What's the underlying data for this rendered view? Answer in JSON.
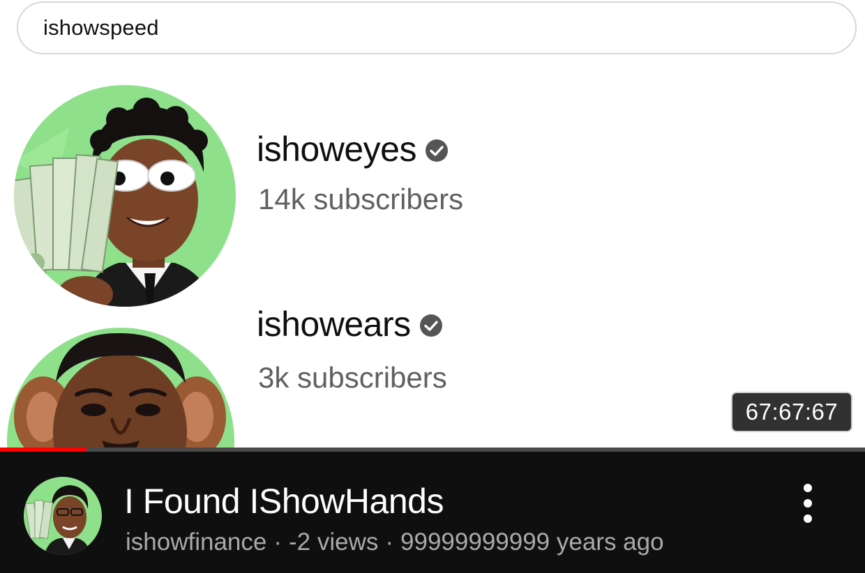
{
  "search": {
    "query": "ishowspeed"
  },
  "results": [
    {
      "name": "ishoweyes",
      "subscribers": "14k subscribers",
      "verified": true,
      "avatar_icon": "avatar-man-with-money-googly-eyes",
      "avatar_bg": "#8ee08a"
    },
    {
      "name": "ishowears",
      "subscribers": "3k subscribers",
      "verified": true,
      "avatar_icon": "avatar-man-with-big-ears",
      "avatar_bg": "#8ee08a"
    }
  ],
  "video": {
    "timestamp": "67:67:67",
    "progress_fraction": 0.1,
    "title": "I Found IShowHands",
    "channel": "ishowfinance",
    "separator": "·",
    "views": "-2 views",
    "age": "99999999999 years ago"
  },
  "colors": {
    "progress": "#ff0000",
    "mini_player_bg": "#0f0f0f",
    "subscriber_text": "#606060",
    "meta_text": "#aaaaaa"
  },
  "icons": {
    "verified": "verified-check-icon",
    "more": "more-vertical-icon"
  }
}
